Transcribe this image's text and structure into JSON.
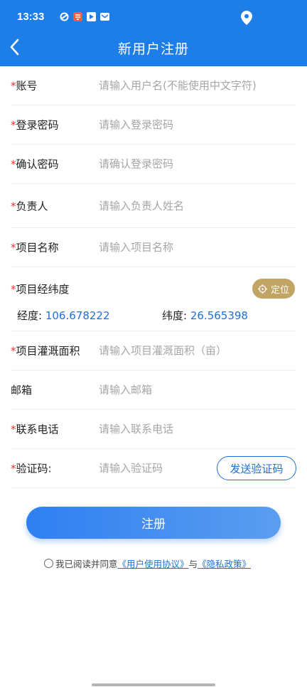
{
  "status_bar": {
    "time": "13:33",
    "icons": [
      "sync-icon",
      "app-notification-icon",
      "media-play-icon",
      "mail-icon"
    ],
    "right_icon": "location-pin-icon"
  },
  "header": {
    "title": "新用户注册",
    "bg_color": "#1e7ee8"
  },
  "form": {
    "account": {
      "required_mark": "*",
      "label": "账号",
      "placeholder": "请输入用户名(不能使用中文字符)"
    },
    "password": {
      "required_mark": "*",
      "label": "登录密码",
      "placeholder": "请输入登录密码"
    },
    "confirm_password": {
      "required_mark": "*",
      "label": "确认密码",
      "placeholder": "请确认登录密码"
    },
    "manager": {
      "required_mark": "*",
      "label": "负责人",
      "placeholder": "请输入负责人姓名"
    },
    "project_name": {
      "required_mark": "*",
      "label": "项目名称",
      "placeholder": "请输入项目名称"
    },
    "geo": {
      "required_mark": "*",
      "label": "项目经纬度",
      "locate_label": "定位",
      "longitude_label": "经度:",
      "longitude_value": "106.678222",
      "latitude_label": "纬度:",
      "latitude_value": "26.565398"
    },
    "irrigation_area": {
      "required_mark": "*",
      "label": "项目灌溉面积",
      "placeholder": "请输入项目灌溉面积（亩）"
    },
    "email": {
      "label": "邮箱",
      "placeholder": "请输入邮箱"
    },
    "phone": {
      "required_mark": "*",
      "label": "联系电话",
      "placeholder": "请输入联系电话"
    },
    "sms_code": {
      "required_mark": "*",
      "label": "验证码:",
      "placeholder": "请输入验证码",
      "send_label": "发送验证码"
    }
  },
  "register_button": "注册",
  "agreement": {
    "prefix": "我已阅读并同意",
    "user_agreement": "《用户使用协议》",
    "conjunction": "与",
    "privacy_policy": "《隐私政策》"
  },
  "colors": {
    "accent": "#1e6fd9",
    "required": "#e53935",
    "locate_button": "#c2a464"
  }
}
